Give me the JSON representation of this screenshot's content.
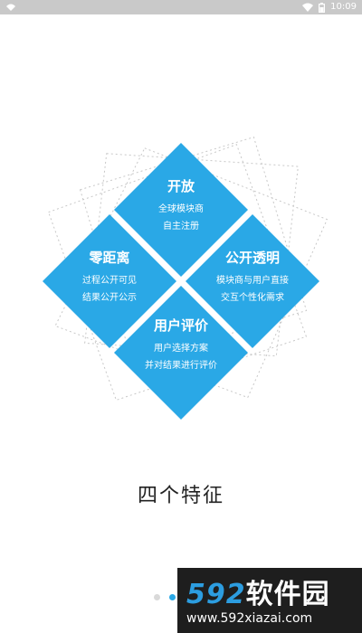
{
  "status_bar": {
    "time": "10:09",
    "icons": [
      "wifi-icon",
      "battery-icon"
    ]
  },
  "diamond": {
    "accent_color": "#2aa8e6",
    "tiles": [
      {
        "title": "开放",
        "lines": [
          "全球模块商",
          "自主注册"
        ]
      },
      {
        "title": "零距离",
        "lines": [
          "过程公开可见",
          "结果公开公示"
        ]
      },
      {
        "title": "公开透明",
        "lines": [
          "模块商与用户直接",
          "交互个性化需求"
        ]
      },
      {
        "title": "用户评价",
        "lines": [
          "用户选择方案",
          "并对结果进行评价"
        ]
      }
    ]
  },
  "main": {
    "title": "四个特征"
  },
  "pager": {
    "total": 3,
    "active": 2
  },
  "watermark": {
    "brand_number": "592",
    "brand_text": "软件园",
    "url": "www.592xiazai.com"
  }
}
